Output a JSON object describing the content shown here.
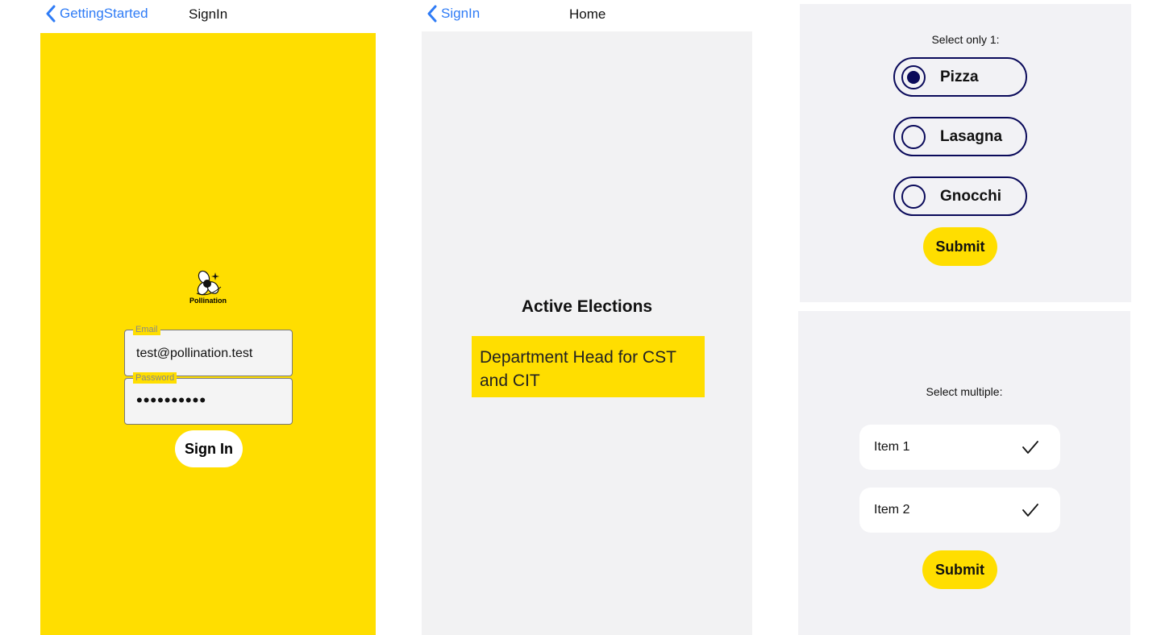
{
  "signin_screen": {
    "nav": {
      "back_label": "GettingStarted",
      "title": "SignIn"
    },
    "logo_text": "Pollination",
    "email": {
      "label": "Email",
      "value": "test@pollination.test"
    },
    "password": {
      "label": "Password",
      "value": "••••••••••"
    },
    "signin_button": "Sign In"
  },
  "home_screen": {
    "nav": {
      "back_label": "SignIn",
      "title": "Home"
    },
    "heading": "Active Elections",
    "elections": [
      "Department Head for CST and CIT"
    ]
  },
  "single_select": {
    "prompt": "Select only 1:",
    "options": [
      {
        "label": "Pizza",
        "selected": true
      },
      {
        "label": "Lasagna",
        "selected": false
      },
      {
        "label": "Gnocchi",
        "selected": false
      }
    ],
    "submit": "Submit"
  },
  "multi_select": {
    "prompt": "Select multiple:",
    "items": [
      {
        "label": "Item 1",
        "checked": true
      },
      {
        "label": "Item 2",
        "checked": true
      }
    ],
    "submit": "Submit"
  },
  "colors": {
    "accent_yellow": "#ffde00",
    "link_blue": "#2f7cf6",
    "radio_navy": "#0a0a5a",
    "panel_gray": "#f2f2f3"
  }
}
